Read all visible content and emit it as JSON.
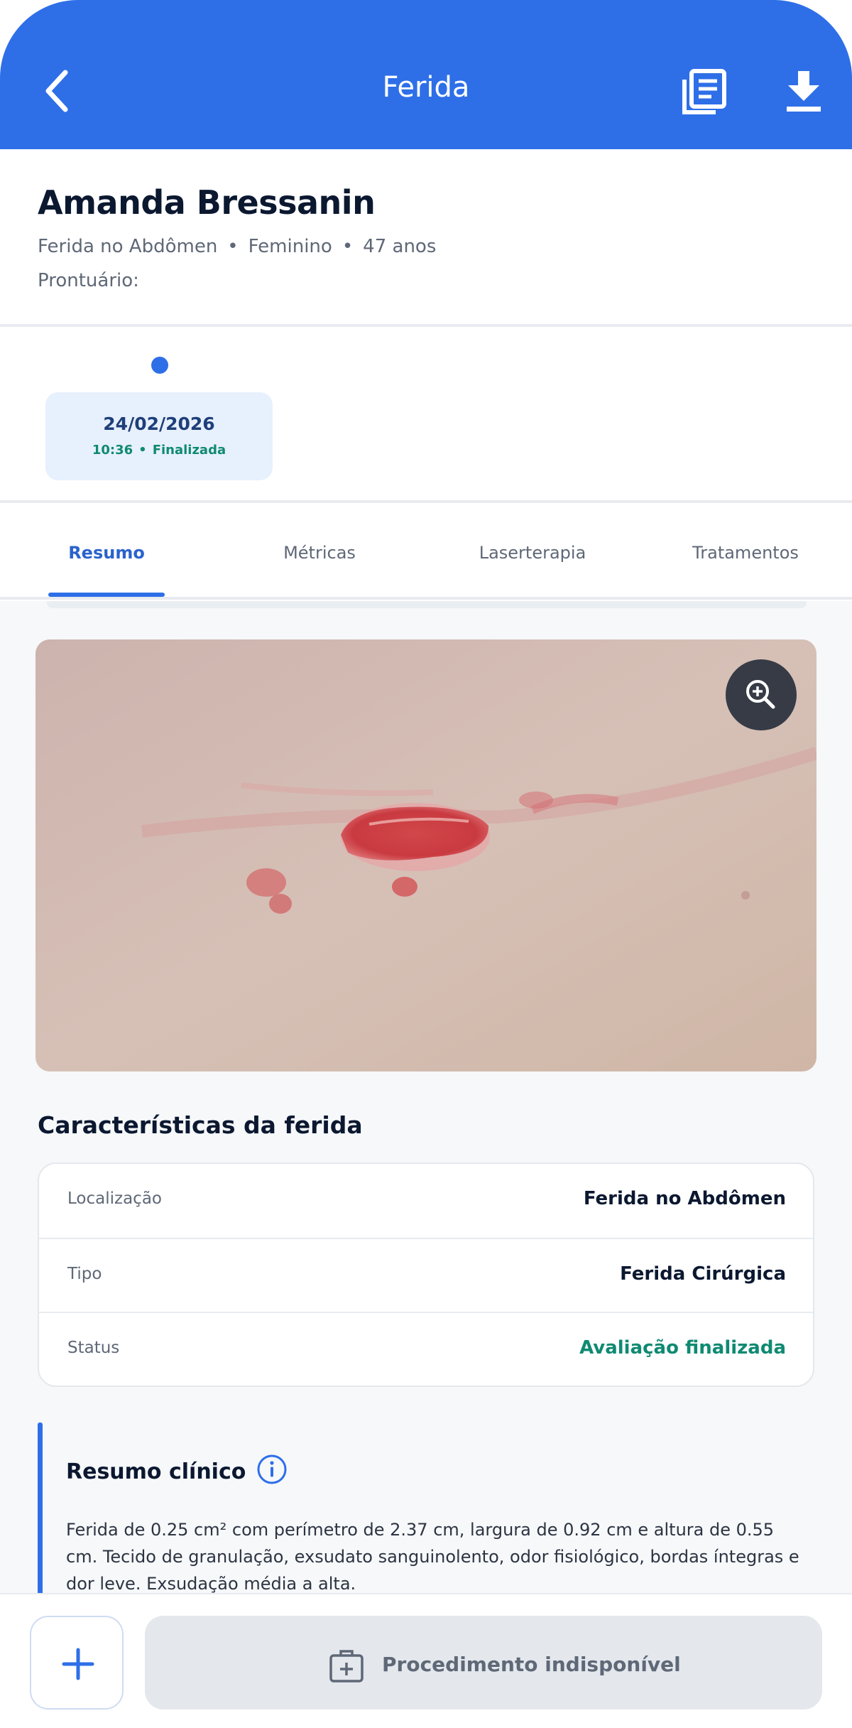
{
  "header": {
    "title": "Ferida",
    "back_icon": "chevron-left-icon",
    "report_icon": "document-list-icon",
    "download_icon": "download-icon",
    "color": "#2e6fe8"
  },
  "patient": {
    "name": "Amanda Bressanin",
    "location": "Ferida no Abdômen",
    "sex": "Feminino",
    "age": "47 anos",
    "separator": "•",
    "record_label": "Prontuário:"
  },
  "timeline": {
    "entries": [
      {
        "date": "24/02/2026",
        "time": "10:36",
        "status": "Finalizada"
      }
    ]
  },
  "tabs": [
    {
      "label": "Resumo",
      "active": true
    },
    {
      "label": "Métricas",
      "active": false
    },
    {
      "label": "Laserterapia",
      "active": false
    },
    {
      "label": "Tratamentos",
      "active": false
    }
  ],
  "photo": {
    "zoom_icon": "zoom-in-icon"
  },
  "characteristics": {
    "title": "Características da ferida",
    "rows": [
      {
        "label": "Localização",
        "value": "Ferida no Abdômen"
      },
      {
        "label": "Tipo",
        "value": "Ferida Cirúrgica"
      },
      {
        "label": "Status",
        "value": "Avaliação finalizada",
        "color": "#0f8a72"
      }
    ]
  },
  "summary": {
    "title": "Resumo clínico",
    "info_icon": "info-icon",
    "text": "Ferida de 0.25 cm² com perímetro de 2.37 cm, largura de 0.92 cm e altura de 0.55 cm. Tecido de granulação, exsudato sanguinolento, odor fisiológico, bordas íntegras e dor leve. Exsudação média a alta."
  },
  "bottom": {
    "add_icon": "plus-icon",
    "procedure_label": "Procedimento indisponível",
    "procedure_icon": "medical-kit-icon"
  }
}
